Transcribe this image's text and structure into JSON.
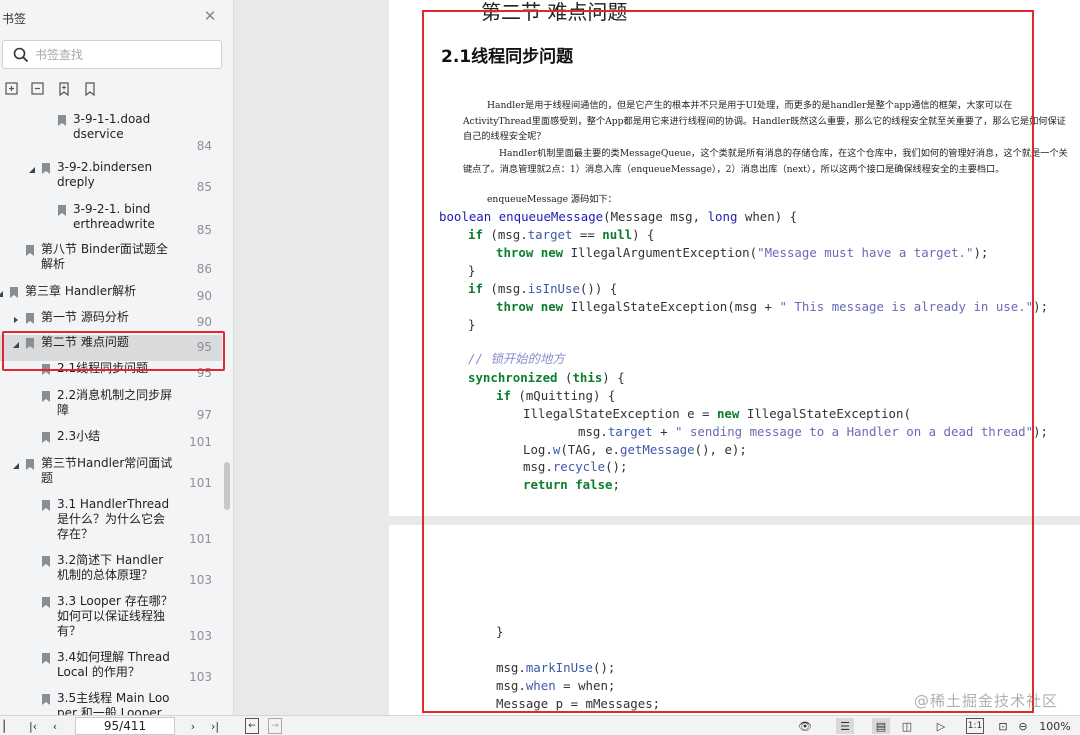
{
  "sidebar": {
    "title": "书签",
    "search_placeholder": "书签查找",
    "items": [
      {
        "label1": "3-9-1-1.doad",
        "label2": "dservice",
        "page": "84"
      },
      {
        "label1": "3-9-2.bindersen",
        "label2": "dreply",
        "page": "85"
      },
      {
        "label1": "3-9-2-1. bind",
        "label2": "erthreadwrite",
        "page": "85"
      },
      {
        "label1": "第八节 Binder面试题全",
        "label2": "解析",
        "page": "86"
      },
      {
        "label1": "第三章 Handler解析",
        "label2": "",
        "page": "90"
      },
      {
        "label1": "第一节 源码分析",
        "label2": "",
        "page": "90"
      },
      {
        "label1": "第二节 难点问题",
        "label2": "",
        "page": "95"
      },
      {
        "label1": "2.1线程同步问题",
        "label2": "",
        "page": "95"
      },
      {
        "label1": "2.2消息机制之同步屏",
        "label2": "障",
        "page": "97"
      },
      {
        "label1": "2.3小结",
        "label2": "",
        "page": "101"
      },
      {
        "label1": "第三节Handler常问面试",
        "label2": "题",
        "page": "101"
      },
      {
        "label1": "3.1 HandlerThread",
        "label2": "是什么？为什么它会",
        "label3": "存在？",
        "page": "101"
      },
      {
        "label1": "3.2简述下 Handler",
        "label2": "机制的总体原理？",
        "page": "103"
      },
      {
        "label1": "3.3 Looper 存在哪？",
        "label2": "如何可以保证线程独",
        "label3": "有？",
        "page": "103"
      },
      {
        "label1": "3.4如何理解 Thread",
        "label2": "Local 的作用？",
        "page": "103"
      },
      {
        "label1": "3.5主线程 Main Loo",
        "label2": "per 和一般 Looper",
        "page": ""
      }
    ]
  },
  "document": {
    "chapter_title": "第二节  难点问题",
    "section_title": "2.1线程同步问题",
    "para1": "Handler是用于线程间通信的，但是它产生的根本并不只是用于UI处理，而更多的是handler是整个app通信的框架，大家可以在ActivityThread里面感受到，整个App都是用它来进行线程间的协调。Handler既然这么重要，那么它的线程安全就至关重要了，那么它是如何保证自己的线程安全呢？",
    "para2": "Handler机制里面最主要的类MessageQueue，这个类就是所有消息的存储仓库，在这个仓库中，我们如何的管理好消息，这个就是一个关键点了。消息管理就2点：1）消息入库（enqueueMessage），2）消息出库（next），所以这两个接口是确保线程安全的主要档口。",
    "para3": "enqueueMessage 源码如下：",
    "code": {
      "l1_kw": "boolean",
      "l1_fn": "enqueueMessage",
      "l1_rest": "(Message msg, ",
      "l1_kw2": "long",
      "l1_end": " when) {",
      "l2_kw": "if",
      "l2_a": " (msg.",
      "l2_f": "target",
      "l2_b": " == ",
      "l2_kw2": "null",
      "l2_c": ") {",
      "l3_kw": "throw new",
      "l3_a": " IllegalArgumentException(",
      "l3_s": "\"Message must have a target.\"",
      "l3_b": ");",
      "l4": "}",
      "l5_kw": "if",
      "l5_a": " (msg.",
      "l5_f": "isInUse",
      "l5_b": "()) {",
      "l6_kw": "throw new",
      "l6_a": " IllegalStateException(msg + ",
      "l6_s": "\" This message is already in use.\"",
      "l6_b": ");",
      "l7": "}",
      "l8_cm": "// 锁开始的地方",
      "l9_kw": "synchronized",
      "l9_a": " (",
      "l9_kw2": "this",
      "l9_b": ") {",
      "l10_kw": "if",
      "l10_a": " (mQuitting) {",
      "l11_a": "IllegalStateException e = ",
      "l11_kw": "new",
      "l11_b": " IllegalStateException(",
      "l12_a": "msg.",
      "l12_f": "target",
      "l12_b": " + ",
      "l12_s": "\" sending message to a Handler on a dead thread\"",
      "l12_c": ");",
      "l13_a": "Log.",
      "l13_f": "w",
      "l13_b": "(TAG, e.",
      "l13_f2": "getMessage",
      "l13_c": "(), e);",
      "l14_a": "msg.",
      "l14_f": "recycle",
      "l14_b": "();",
      "l15_kw": "return false",
      "l15_b": ";",
      "p2_l1": "}",
      "p2_l2_a": "msg.",
      "p2_l2_f": "markInUse",
      "p2_l2_b": "();",
      "p2_l3_a": "msg.",
      "p2_l3_f": "when",
      "p2_l3_b": " = when;",
      "p2_l4": "Message p = mMessages;"
    }
  },
  "bottombar": {
    "page_indicator": "95/411",
    "zoom": "100%"
  },
  "watermark": "@稀土掘金技术社区",
  "colors": {
    "highlight": "#e0282d",
    "keyword": "#0b7f2b",
    "string": "#6a6ab8"
  }
}
